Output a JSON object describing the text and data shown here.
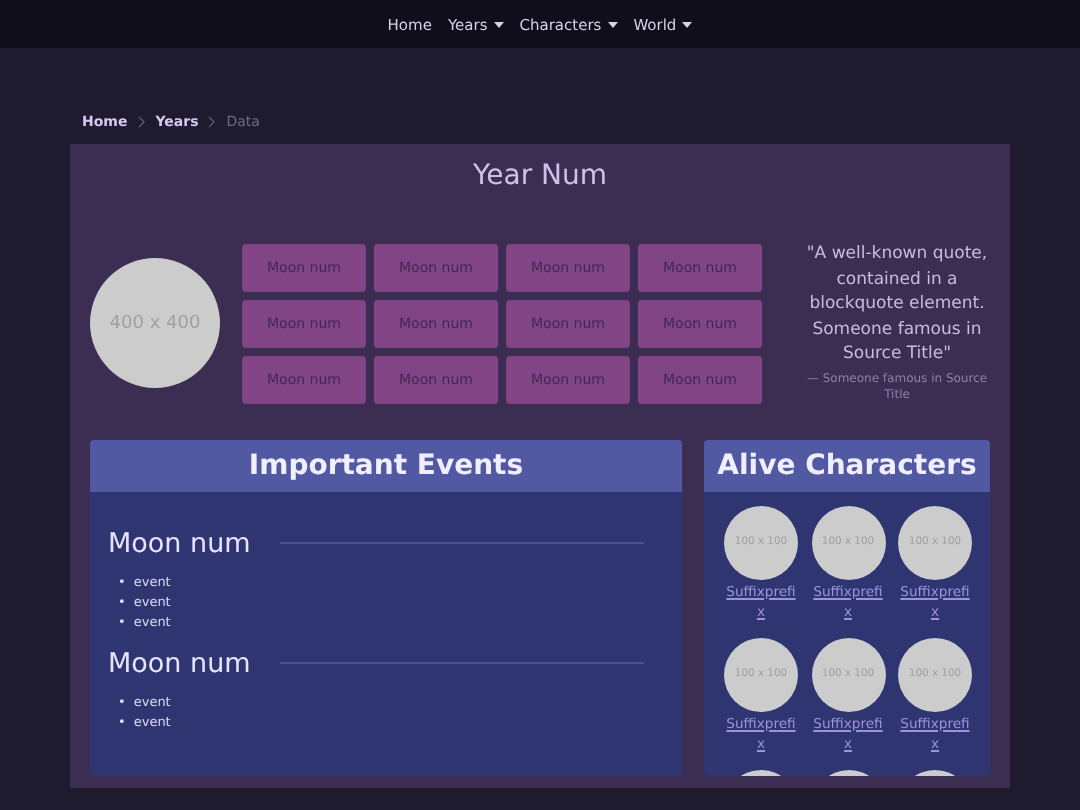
{
  "nav": [
    {
      "label": "Home",
      "dropdown": false
    },
    {
      "label": "Years",
      "dropdown": true
    },
    {
      "label": "Characters",
      "dropdown": true
    },
    {
      "label": "World",
      "dropdown": true
    }
  ],
  "breadcrumb": [
    {
      "label": "Home",
      "current": false
    },
    {
      "label": "Years",
      "current": false
    },
    {
      "label": "Data",
      "current": true
    }
  ],
  "year": {
    "title": "Year Num",
    "image_label": "400 x 400",
    "moons": [
      "Moon num",
      "Moon num",
      "Moon num",
      "Moon num",
      "Moon num",
      "Moon num",
      "Moon num",
      "Moon num",
      "Moon num",
      "Moon num",
      "Moon num",
      "Moon num"
    ],
    "quote": {
      "text": "\"A well-known quote, contained in a blockquote element. Someone famous in Source Title\"",
      "source": "— Someone famous in Source Title"
    }
  },
  "events": {
    "title": "Important Events",
    "bullet": "•",
    "sections": [
      {
        "heading": "Moon num",
        "items": [
          "event",
          "event",
          "event"
        ]
      },
      {
        "heading": "Moon num",
        "items": [
          "event",
          "event"
        ]
      }
    ]
  },
  "characters": {
    "title": "Alive Characters",
    "items": [
      {
        "kind": "full",
        "image_label": "100 x 100",
        "name": "Suffixprefix"
      },
      {
        "kind": "full",
        "image_label": "100 x 100",
        "name": "Suffixprefix"
      },
      {
        "kind": "full",
        "image_label": "100 x 100",
        "name": "Suffixprefix"
      },
      {
        "kind": "full",
        "image_label": "100 x 100",
        "name": "Suffixprefix"
      },
      {
        "kind": "full",
        "image_label": "100 x 100",
        "name": "Suffixprefix"
      },
      {
        "kind": "full",
        "image_label": "100 x 100",
        "name": "Suffixprefix"
      },
      {
        "kind": "cut"
      },
      {
        "kind": "cut"
      },
      {
        "kind": "cut"
      }
    ]
  }
}
